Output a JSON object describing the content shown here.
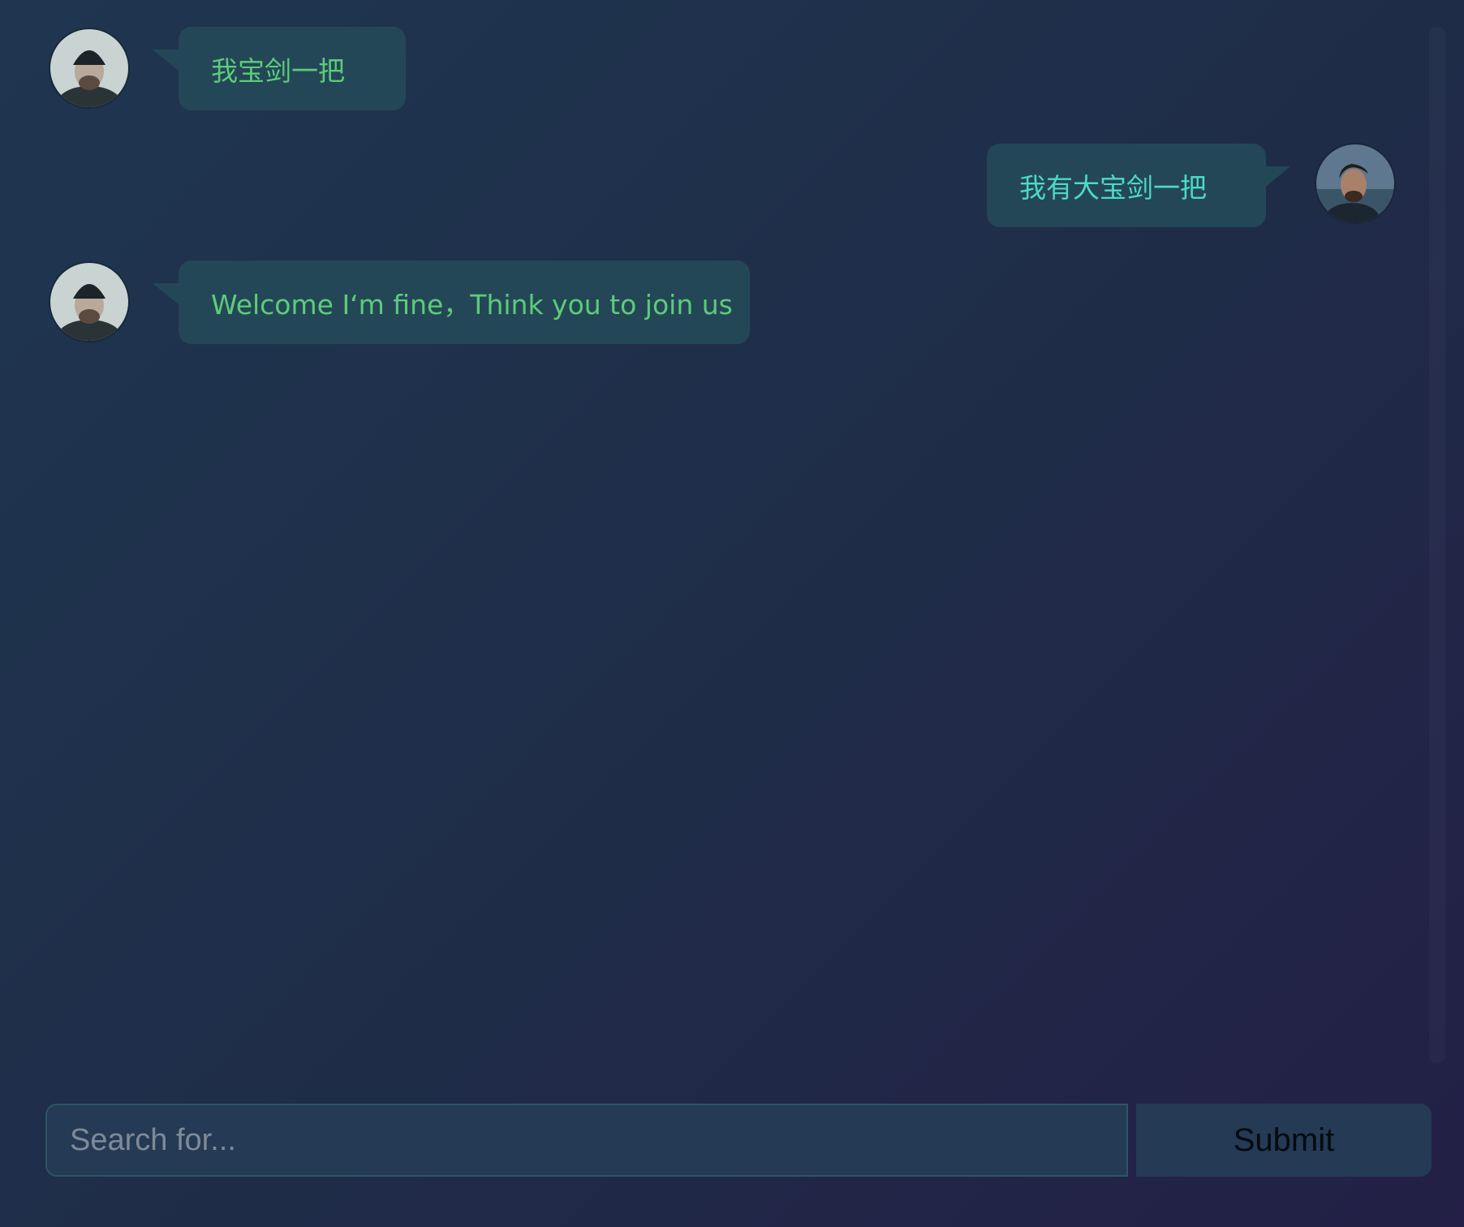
{
  "messages": [
    {
      "side": "left",
      "avatar": "person-beanie-avatar",
      "text": "我宝剑一把"
    },
    {
      "side": "right",
      "avatar": "person-dark-hair-avatar",
      "text": "我有大宝剑一把"
    },
    {
      "side": "left",
      "avatar": "person-beanie-avatar",
      "text": "Welcome I‘m fine，Think you to join us"
    }
  ],
  "composer": {
    "placeholder": "Search for...",
    "value": "",
    "submit_label": "Submit"
  },
  "colors": {
    "bubble": "#244757",
    "incoming_text": "#5ccc7a",
    "outgoing_text": "#4dd9c5",
    "background_start": "#1f3650",
    "background_end": "#231f46"
  }
}
